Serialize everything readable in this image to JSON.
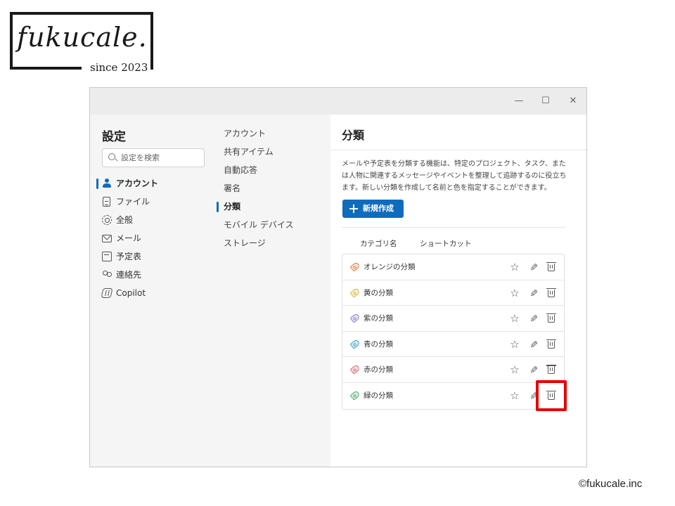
{
  "logo": {
    "script_text": "fukucale.",
    "since": "since 2023"
  },
  "window": {
    "controls": {
      "minimize": "—",
      "maximize": "☐",
      "close": "✕"
    }
  },
  "settings": {
    "title": "設定",
    "search_placeholder": "設定を検索",
    "nav": [
      {
        "label": "アカウント",
        "icon": "person-icon",
        "active": true
      },
      {
        "label": "ファイル",
        "icon": "file-icon",
        "active": false
      },
      {
        "label": "全般",
        "icon": "gear-icon",
        "active": false
      },
      {
        "label": "メール",
        "icon": "mail-icon",
        "active": false
      },
      {
        "label": "予定表",
        "icon": "calendar-icon",
        "active": false
      },
      {
        "label": "連絡先",
        "icon": "people-icon",
        "active": false
      },
      {
        "label": "Copilot",
        "icon": "copilot-icon",
        "active": false
      }
    ]
  },
  "subnav": [
    {
      "label": "アカウント",
      "active": false
    },
    {
      "label": "共有アイテム",
      "active": false
    },
    {
      "label": "自動応答",
      "active": false
    },
    {
      "label": "署名",
      "active": false
    },
    {
      "label": "分類",
      "active": true
    },
    {
      "label": "モバイル デバイス",
      "active": false
    },
    {
      "label": "ストレージ",
      "active": false
    }
  ],
  "categories_pane": {
    "title": "分類",
    "description": "メールや予定表を分類する機能は、特定のプロジェクト、タスク、または人物に関連するメッセージやイベントを整理して追跡するのに役立ちます。新しい分類を作成して名前と色を指定することができます。",
    "new_button_label": "新規作成",
    "columns": {
      "name": "カテゴリ名",
      "shortcut": "ショートカット"
    },
    "categories": [
      {
        "label": "オレンジの分類",
        "color": "#e07a3a"
      },
      {
        "label": "黄の分類",
        "color": "#d9b53a"
      },
      {
        "label": "紫の分類",
        "color": "#8a7cc9"
      },
      {
        "label": "青の分類",
        "color": "#3a9fc9"
      },
      {
        "label": "赤の分類",
        "color": "#d9646e"
      },
      {
        "label": "緑の分類",
        "color": "#4ea86a"
      }
    ],
    "highlight_color": "#e60000"
  },
  "copyright": "©fukucale.inc"
}
